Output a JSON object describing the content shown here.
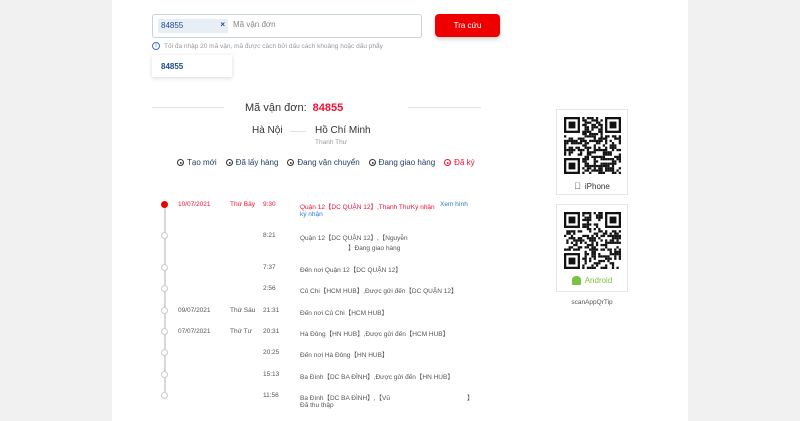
{
  "search": {
    "chip_value": "84855",
    "placeholder": "Mã vận đơn",
    "button": "Tra cứu",
    "hint": "Tối đa nhập 20 mã vận, mã được cách bởi dấu cách khoảng hoặc dấu phẩy",
    "suggestion": "84855"
  },
  "result": {
    "label": "Mã vận đơn:",
    "code": "84855",
    "from": "Hà Nội",
    "to": "Hồ Chí Minh",
    "to_sub": "Thanh Thư"
  },
  "steps": [
    "Tạo mới",
    "Đã lấy hàng",
    "Đang vận chuyển",
    "Đang giao hàng",
    "Đã ký"
  ],
  "timeline": [
    {
      "date": "10/07/2021",
      "day": "Thứ Bảy",
      "time": "9:30",
      "text": "Quận 12【DC QUẬN 12】,Thanh ThưKý nhận",
      "link": "Xem hình",
      "link2": "ký nhận"
    },
    {
      "date": "",
      "day": "",
      "time": "8:21",
      "text": "Quận 12【DC QUẬN 12】,【Nguyễn",
      "text2": "】Đang giao hàng"
    },
    {
      "date": "",
      "day": "",
      "time": "7:37",
      "text": "Đến nơi Quận 12【DC QUẬN 12】"
    },
    {
      "date": "",
      "day": "",
      "time": "2:56",
      "text": "Củ Chi【HCM HUB】,Được gửi đến【DC QUẬN 12】"
    },
    {
      "date": "09/07/2021",
      "day": "Thứ Sáu",
      "time": "21:31",
      "text": "Đến nơi Củ Chi【HCM HUB】"
    },
    {
      "date": "07/07/2021",
      "day": "Thứ Tư",
      "time": "20:31",
      "text": "Hà Đông【HN HUB】,Được gửi đến【HCM HUB】"
    },
    {
      "date": "",
      "day": "",
      "time": "20:25",
      "text": "Đến nơi Hà Đông【HN HUB】"
    },
    {
      "date": "",
      "day": "",
      "time": "15:13",
      "text": "Ba Đình【DC BA ĐÌNH】,Được gửi đến【HN HUB】"
    },
    {
      "date": "",
      "day": "",
      "time": "11:56",
      "text": "Ba Đình【DC BA ĐÌNH】,【Vũ",
      "text2": "Đã thu thập",
      "bracket": "】"
    }
  ],
  "apps": {
    "iphone": "iPhone",
    "android": "Android",
    "tip": "scanAppQrTip"
  },
  "colors": {
    "accent": "#ee0000",
    "link": "#2a7bd4",
    "android": "#7cc242"
  }
}
